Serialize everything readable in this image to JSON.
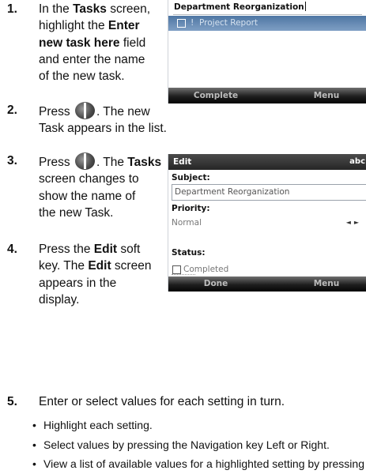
{
  "steps": [
    {
      "num": "1.",
      "lines": [
        [
          {
            "t": "In the "
          },
          {
            "t": "Tasks",
            "b": true
          },
          {
            "t": " screen,"
          }
        ],
        [
          {
            "t": "highlight the "
          },
          {
            "t": "Enter",
            "b": true
          }
        ],
        [
          {
            "t": "new task here",
            "b": true
          },
          {
            "t": " field"
          }
        ],
        [
          {
            "t": "and enter the name"
          }
        ],
        [
          {
            "t": "of the new task."
          }
        ]
      ]
    },
    {
      "num": "2.",
      "lines": [
        [
          {
            "t": "Press "
          },
          {
            "key": "ok-key"
          },
          {
            "t": ". The new"
          }
        ],
        [
          {
            "t": "Task appears in the list."
          }
        ]
      ]
    },
    {
      "num": "3.",
      "lines": [
        [
          {
            "t": "Press "
          },
          {
            "key": "ok-key"
          },
          {
            "t": ". The "
          },
          {
            "t": "Tasks",
            "b": true
          }
        ],
        [
          {
            "t": "screen changes to"
          }
        ],
        [
          {
            "t": "show the name of"
          }
        ],
        [
          {
            "t": "the new Task."
          }
        ]
      ]
    },
    {
      "num": "4.",
      "lines": [
        [
          {
            "t": "Press the "
          },
          {
            "t": "Edit",
            "b": true
          },
          {
            "t": " soft"
          }
        ],
        [
          {
            "t": "key. The "
          },
          {
            "t": "Edit",
            "b": true
          },
          {
            "t": " screen"
          }
        ],
        [
          {
            "t": "appears in the"
          }
        ],
        [
          {
            "t": "display."
          }
        ]
      ]
    },
    {
      "num": "5.",
      "lines": [
        [
          {
            "t": "Enter or select values for each setting in turn."
          }
        ]
      ]
    }
  ],
  "bullets": [
    "Highlight each setting.",
    "Select values by pressing the Navigation key Left or Right.",
    "View a list of available values for a highlighted setting by pressing"
  ],
  "screen1": {
    "field_text": "Department Reorganization",
    "row_priority": "!",
    "row_text": "Project Report",
    "softkey_left": "Complete",
    "softkey_right": "Menu"
  },
  "screen2": {
    "title": "Edit",
    "input_mode": "abc",
    "subject_label": "Subject:",
    "subject_value": "Department Reorganization",
    "priority_label": "Priority:",
    "priority_value": "Normal",
    "priority_arrows": "◄►",
    "status_label": "Status:",
    "status_value": "Completed",
    "softkey_left": "Done",
    "softkey_right": "Menu"
  }
}
